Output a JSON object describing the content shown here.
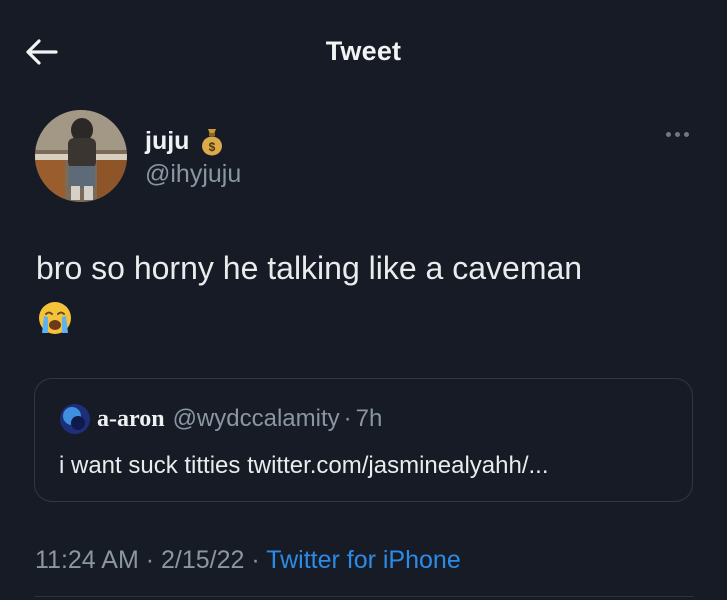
{
  "header": {
    "title": "Tweet",
    "back_icon": "arrow-left-icon"
  },
  "author": {
    "display_name": "juju",
    "badge_icon": "money-bag-icon",
    "handle": "@ihyjuju",
    "more_icon": "more-horizontal-icon"
  },
  "tweet": {
    "text": "bro so horny he talking like a caveman",
    "emoji_icon": "loudly-crying-face-icon"
  },
  "quote": {
    "name": "a-aron",
    "handle": "@wydccalamity",
    "separator": "·",
    "time": "7h",
    "text": "i want suck titties twitter.com/jasminealyahh/..."
  },
  "meta": {
    "time": "11:24 AM",
    "sep1": " · ",
    "date": "2/15/22",
    "sep2": " · ",
    "source": "Twitter for iPhone"
  },
  "colors": {
    "background": "#161b25",
    "text": "#e7e9ea",
    "secondary": "#8b96a3",
    "link": "#2b8be6"
  }
}
